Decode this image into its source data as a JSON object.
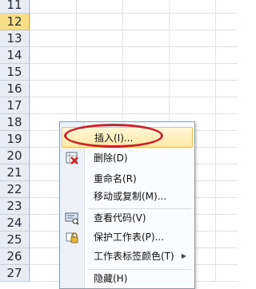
{
  "rows": [
    {
      "num": "11"
    },
    {
      "num": "12"
    },
    {
      "num": "13"
    },
    {
      "num": "14"
    },
    {
      "num": "15"
    },
    {
      "num": "16"
    },
    {
      "num": "17"
    },
    {
      "num": "18"
    },
    {
      "num": "19"
    },
    {
      "num": "20"
    },
    {
      "num": "21"
    },
    {
      "num": "22"
    },
    {
      "num": "23"
    },
    {
      "num": "24"
    },
    {
      "num": "25"
    },
    {
      "num": "26"
    },
    {
      "num": "27"
    }
  ],
  "active_row": "12",
  "context_menu": {
    "insert": "插入(I)...",
    "delete": "删除(D)",
    "rename": "重命名(R)",
    "move_copy": "移动或复制(M)...",
    "view_code": "查看代码(V)",
    "protect_sheet": "保护工作表(P)...",
    "tab_color": "工作表标签颜色(T)",
    "hide": "隐藏(H)"
  },
  "colors": {
    "active_row_header": "#f7df8a",
    "row_header": "#e9edf3",
    "highlight": "#c8232c",
    "menu_hover": "#ffe9a8"
  }
}
